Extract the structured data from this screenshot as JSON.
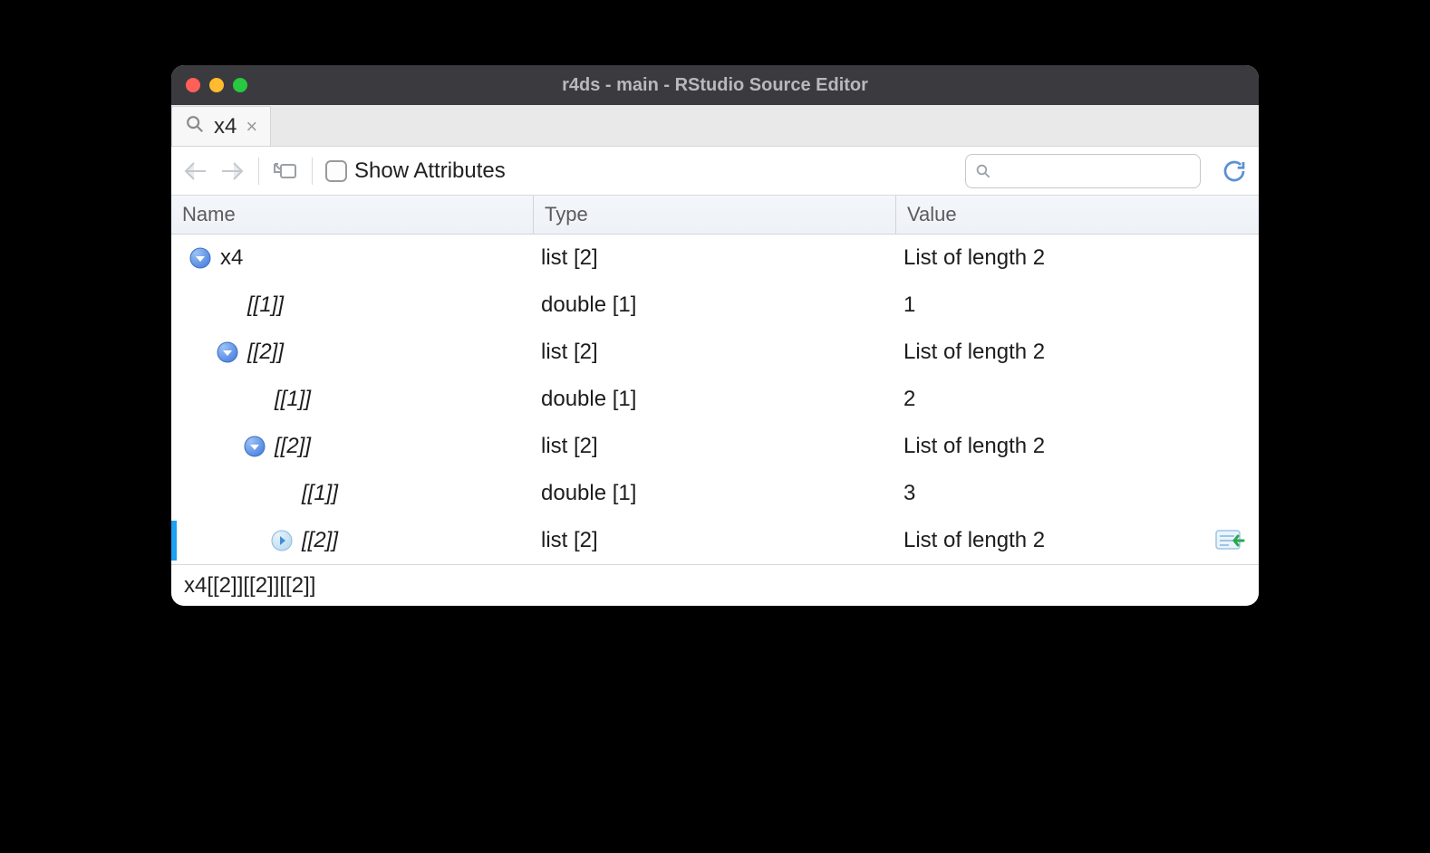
{
  "window": {
    "title": "r4ds - main - RStudio Source Editor"
  },
  "tab": {
    "label": "x4"
  },
  "toolbar": {
    "show_attributes_label": "Show Attributes",
    "search_placeholder": ""
  },
  "columns": {
    "name": "Name",
    "type": "Type",
    "value": "Value"
  },
  "rows": [
    {
      "indent": 0,
      "toggle": "down",
      "label": "x4",
      "italic": false,
      "type": "list [2]",
      "value": "List of length 2",
      "selected": false,
      "send": false
    },
    {
      "indent": 1,
      "toggle": "",
      "label": "[[1]]",
      "italic": true,
      "type": "double [1]",
      "value": "1",
      "selected": false,
      "send": false
    },
    {
      "indent": 1,
      "toggle": "down",
      "label": "[[2]]",
      "italic": true,
      "type": "list [2]",
      "value": "List of length 2",
      "selected": false,
      "send": false
    },
    {
      "indent": 2,
      "toggle": "",
      "label": "[[1]]",
      "italic": true,
      "type": "double [1]",
      "value": "2",
      "selected": false,
      "send": false
    },
    {
      "indent": 2,
      "toggle": "down",
      "label": "[[2]]",
      "italic": true,
      "type": "list [2]",
      "value": "List of length 2",
      "selected": false,
      "send": false
    },
    {
      "indent": 3,
      "toggle": "",
      "label": "[[1]]",
      "italic": true,
      "type": "double [1]",
      "value": "3",
      "selected": false,
      "send": false
    },
    {
      "indent": 3,
      "toggle": "right",
      "label": "[[2]]",
      "italic": true,
      "type": "list [2]",
      "value": "List of length 2",
      "selected": true,
      "send": true
    }
  ],
  "footer": {
    "path": "x4[[2]][[2]][[2]]"
  }
}
